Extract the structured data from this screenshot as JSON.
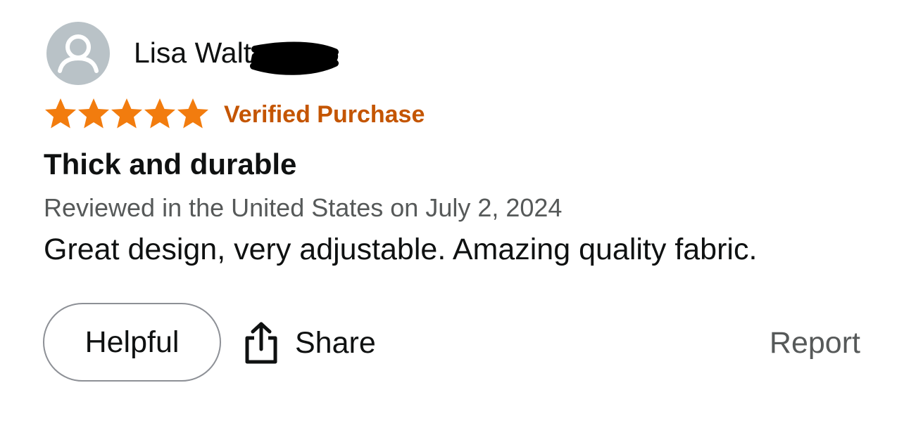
{
  "review": {
    "reviewer_name": "Lisa Walt",
    "rating": 5,
    "rating_max": 5,
    "star_color": "#f27c0e",
    "verified_label": "Verified Purchase",
    "verified_color": "#c45500",
    "title": "Thick and durable",
    "meta": "Reviewed in the United States on July 2, 2024",
    "body": "Great design, very adjustable. Amazing quality fabric."
  },
  "icons": {
    "avatar": "default-user-icon",
    "star": "star-icon",
    "share": "share-icon"
  },
  "actions": {
    "helpful_label": "Helpful",
    "share_label": "Share",
    "report_label": "Report"
  }
}
